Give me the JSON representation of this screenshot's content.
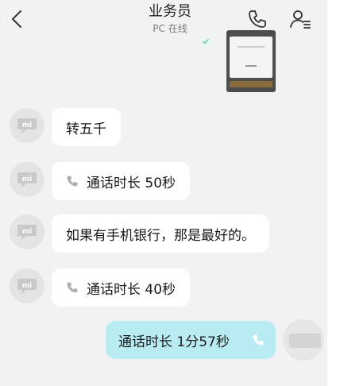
{
  "header": {
    "title": "业务员",
    "subtitle": "PC 在线",
    "back_icon": "chevron-left-icon",
    "call_icon": "phone-icon",
    "contact_icon": "contact-profile-icon"
  },
  "messages": [
    {
      "side": "left",
      "text": "转五千"
    },
    {
      "side": "left",
      "type": "call",
      "text": "通话时长  50秒"
    },
    {
      "side": "left",
      "text": "如果有手机银行，那是最好的。"
    },
    {
      "side": "left",
      "type": "call",
      "text": "通话时长  40秒"
    },
    {
      "side": "right",
      "type": "call",
      "text": "通话时长  1分57秒"
    }
  ],
  "colors": {
    "background": "#f2f2f2",
    "incoming_bubble": "#ffffff",
    "outgoing_bubble": "#b8ecf2",
    "avatar": "#e4e4e4"
  }
}
